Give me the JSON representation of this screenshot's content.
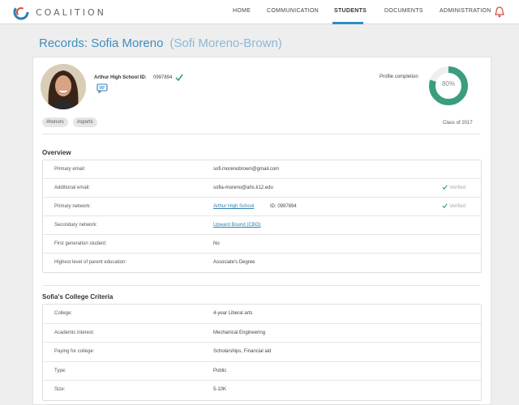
{
  "header": {
    "brand": "COALITION",
    "nav": [
      {
        "label": "HOME",
        "active": false
      },
      {
        "label": "COMMUNICATION",
        "active": false
      },
      {
        "label": "STUDENTS",
        "active": true
      },
      {
        "label": "DOCUMENTS",
        "active": false
      },
      {
        "label": "ADMINISTRATION",
        "active": false
      }
    ]
  },
  "page": {
    "title": "Records: Sofia Moreno",
    "alias": "(Sofi Moreno-Brown)"
  },
  "profile": {
    "school_id_label": "Arthur High School ID:",
    "school_id_value": "0997894",
    "completion_label": "Profile completion",
    "completion_text": "80%",
    "completion_fraction": 0.8,
    "tags": [
      "#honors",
      "#sports"
    ],
    "class_of": "Class of 2017"
  },
  "overview": {
    "title": "Overview",
    "rows": [
      {
        "label": "Primary email:",
        "value": "sofi.morenobrown@gmail.com"
      },
      {
        "label": "Additional email:",
        "value": "sofia-moreno@ahs.k12.edu",
        "status": "Verified"
      },
      {
        "label": "Primary network:",
        "link": "Arthur High School",
        "id": "ID:  0997894",
        "status": "Verified"
      },
      {
        "label": "Secondary network:",
        "link": "Upward Bound (CBO)"
      },
      {
        "label": "First generation student:",
        "value": "No"
      },
      {
        "label": "Highest level of parent education:",
        "value": "Associate's Degree"
      }
    ]
  },
  "criteria": {
    "title": "Sofia's College Criteria",
    "rows": [
      {
        "label": "College:",
        "value": "4-year Liberal arts"
      },
      {
        "label": "Academic interest:",
        "value": "Mechanical Engineering"
      },
      {
        "label": "Paying for college:",
        "value": "Scholarships, Financial aid"
      },
      {
        "label": "Type:",
        "value": "Public"
      },
      {
        "label": "Size:",
        "value": "5-10K"
      }
    ]
  },
  "colors": {
    "accent": "#3e8dbf",
    "donut": "#3b9d7f",
    "verified": "#3b9d7f"
  }
}
